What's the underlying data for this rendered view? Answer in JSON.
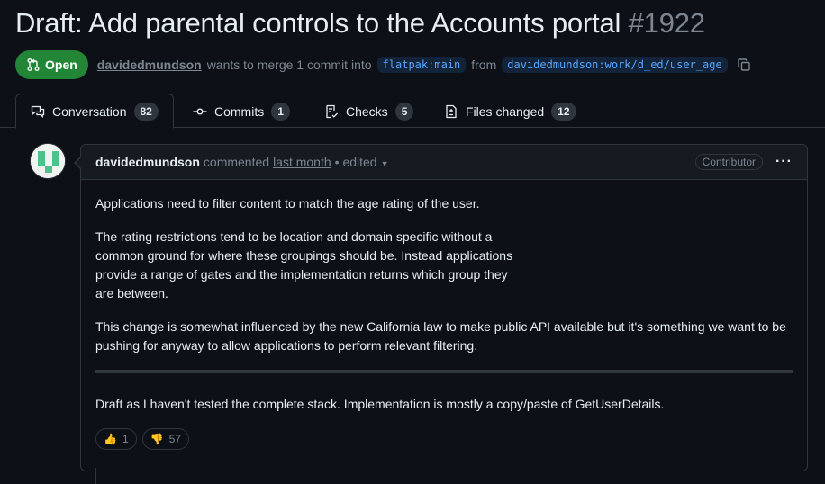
{
  "pr": {
    "title": "Draft: Add parental controls to the Accounts portal",
    "number": "#1922",
    "state": "Open",
    "author": "davidedmundson",
    "merge_text": "wants to merge 1 commit into",
    "base_branch": "flatpak:main",
    "from_text": "from",
    "head_branch": "davidedmundson:work/d_ed/user_age"
  },
  "tabs": [
    {
      "label": "Conversation",
      "count": "82",
      "icon": "comment-discussion-icon"
    },
    {
      "label": "Commits",
      "count": "1",
      "icon": "git-commit-icon"
    },
    {
      "label": "Checks",
      "count": "5",
      "icon": "checklist-icon"
    },
    {
      "label": "Files changed",
      "count": "12",
      "icon": "file-diff-icon"
    }
  ],
  "comment": {
    "author": "davidedmundson",
    "action": "commented",
    "when": "last month",
    "edited": "• edited",
    "role": "Contributor",
    "paragraphs": [
      "Applications need to filter content to match the age rating of the user.",
      "The rating restrictions tend to be location and domain specific without a common ground for where these groupings should be. Instead applications provide a range of gates and the implementation returns which group they are between.",
      "This change is somewhat influenced by the new California law to make public API available but it's something we want to be pushing for anyway to allow applications to perform relevant filtering.",
      "Draft as I haven't tested the complete stack. Implementation is mostly a copy/paste of GetUserDetails."
    ],
    "reactions": [
      {
        "emoji": "👍",
        "count": "1"
      },
      {
        "emoji": "👎",
        "count": "57"
      }
    ]
  },
  "colors": {
    "background": "#0d1117",
    "open_green": "#238636",
    "link_blue": "#58a6ff",
    "border": "#30363d"
  }
}
